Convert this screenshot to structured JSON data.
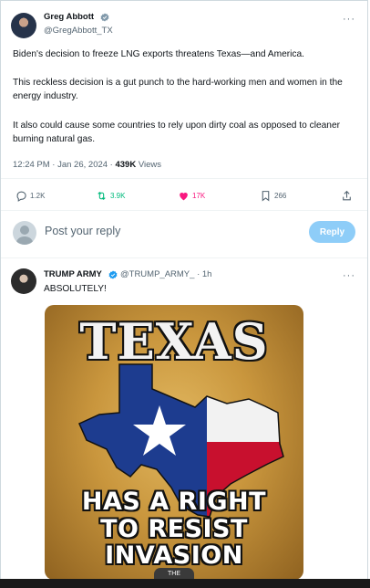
{
  "tweet": {
    "author_name": "Greg Abbott",
    "author_handle": "@GregAbbott_TX",
    "paragraphs": [
      "Biden's decision to freeze LNG exports threatens Texas—and America.",
      "This reckless decision is a gut punch to the hard-working men and women in the energy industry.",
      "It also could cause some countries to rely upon dirty coal as opposed to cleaner burning natural gas."
    ],
    "timestamp": "12:24 PM · Jan 26, 2024 · ",
    "views_count": "439K",
    "views_label": " Views",
    "more_label": "···"
  },
  "actions": {
    "replies": "1.2K",
    "reposts": "3.9K",
    "likes": "17K",
    "bookmarks": "266"
  },
  "composer": {
    "placeholder": "Post your reply",
    "reply_button": "Reply"
  },
  "reply": {
    "author_name": "TRUMP ARMY",
    "author_handle": "@TRUMP_ARMY_ · 1h",
    "text": "ABSOLUTELY!",
    "more_label": "···",
    "meme": {
      "title": "TEXAS",
      "line1": "HAS A RIGHT",
      "line2": "TO RESIST",
      "line3": "INVASION",
      "badge": "THE"
    }
  },
  "colors": {
    "verified": "#1d9bf0",
    "repost": "#00ba7c",
    "like": "#f91880",
    "reply_button": "#8ecdf8",
    "flag_blue": "#1d3c8f",
    "flag_red": "#c8102e"
  }
}
